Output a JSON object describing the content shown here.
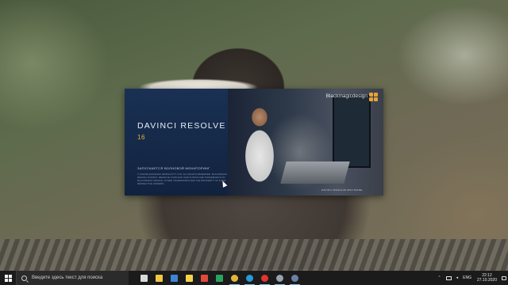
{
  "splash": {
    "title": "DAVINCI RESOLVE",
    "version": "16",
    "status": "ЗАПУСКАЕТСЯ ВОЛНОВОЙ МОНИТОРИНГ",
    "legal": "© 2019 BLACKMAGIC DESIGN PTY. LTD. ALL RIGHTS RESERVED. BLACKMAGIC DESIGN, DAVINCI, RESOLVE, FAIRLIGHT AND FUSION ARE TRADEMARKS OF BLACKMAGIC DESIGN. OTHER TRADEMARKS ARE THE PROPERTY OF THEIR RESPECTIVE OWNERS.",
    "brand": "Blackmagicdesign",
    "caption": "DAVINCI RESOLVE MINI PANEL",
    "accent_color": "#e7b240"
  },
  "taskbar": {
    "search_placeholder": "Введите здесь текст для поиска",
    "icons": [
      {
        "name": "task-view-icon",
        "color": "#d9d9d9"
      },
      {
        "name": "file-explorer-icon",
        "color": "#f2c744"
      },
      {
        "name": "calendar-icon",
        "color": "#3a86d4"
      },
      {
        "name": "sticky-notes-icon",
        "color": "#f3d34a"
      },
      {
        "name": "gmail-icon",
        "color": "#e04a3a"
      },
      {
        "name": "sheets-icon",
        "color": "#2ca25f"
      },
      {
        "name": "chrome-icon",
        "color": "#e2b53b"
      },
      {
        "name": "skype-icon",
        "color": "#2a9ad8"
      },
      {
        "name": "opera-icon",
        "color": "#e3342f"
      },
      {
        "name": "steam-icon",
        "color": "#9aa3ad"
      },
      {
        "name": "davinci-resolve-icon",
        "color": "#6c7fa8"
      }
    ],
    "language": "ENG",
    "time": "22:12",
    "date": "27.10.2020"
  }
}
